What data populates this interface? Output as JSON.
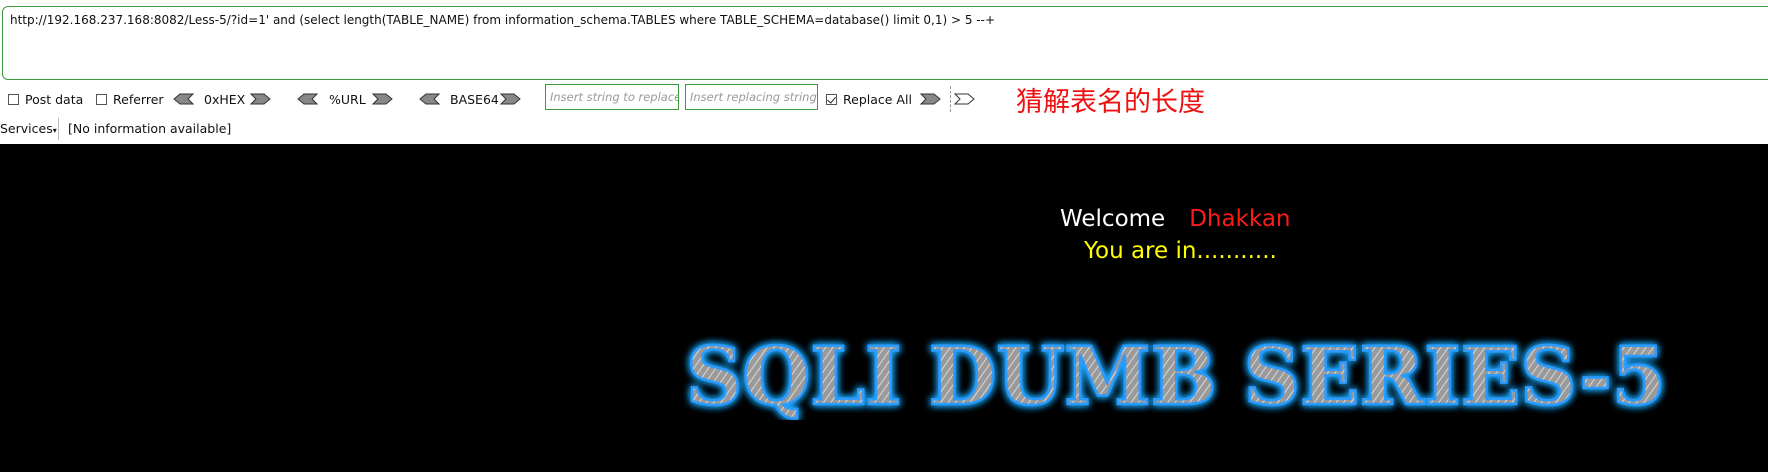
{
  "hackbar": {
    "url": "http://192.168.237.168:8082/Less-5/?id=1' and (select length(TABLE_NAME) from information_schema.TABLES where TABLE_SCHEMA=database() limit 0,1) > 5 --+",
    "post_data_label": "Post data",
    "referrer_label": "Referrer",
    "hex_label": "0xHEX",
    "url_label": "%URL",
    "base64_label": "BASE64",
    "insert_placeholder": "Insert string to replace",
    "replacing_placeholder": "Insert replacing string",
    "replace_all_label": "Replace All",
    "replace_all_checked": true
  },
  "annotation": "猜解表名的长度",
  "statusbar": {
    "services_label": "Services",
    "info_text": "[No information available]"
  },
  "page": {
    "welcome": "Welcome",
    "name": "Dhakkan",
    "status": "You are in...........",
    "banner": "SQLI DUMB SERIES-5"
  },
  "colors": {
    "field_border": "#3c9a3c",
    "annotation": "#ee1111",
    "name": "#ff1a1a",
    "status": "#ffff00",
    "banner_glow": "#1ea8ff"
  }
}
